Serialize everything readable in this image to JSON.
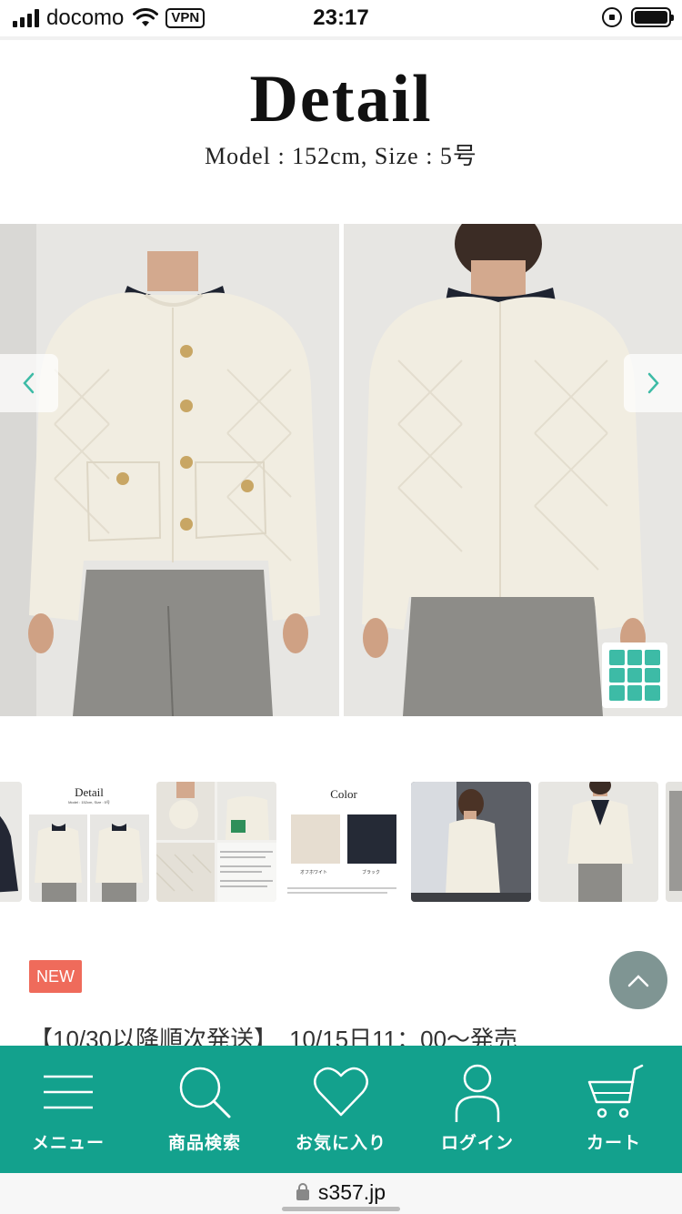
{
  "status_bar": {
    "carrier": "docomo",
    "vpn": "VPN",
    "time": "23:17",
    "signal_bars": 4,
    "battery_level": 1.0
  },
  "detail": {
    "title": "Detail",
    "subtitle": "Model : 152cm, Size : 5号"
  },
  "gallery": {
    "prev_icon": "chevron-left-icon",
    "next_icon": "chevron-right-icon",
    "grid_icon": "grid-icon"
  },
  "thumbnails": {
    "detail_card": {
      "title": "Detail",
      "subtitle": "Model : 152cm, Size : 5号"
    },
    "color_card": {
      "title": "Color",
      "swatches": [
        {
          "label": "オフホワイト",
          "color": "#e6ddd0"
        },
        {
          "label": "ブラック",
          "color": "#252a36"
        }
      ]
    }
  },
  "product": {
    "badge": "NEW",
    "title": "【10/30以降順次発送】　10/15日11：00〜発売"
  },
  "bottom_nav": {
    "items": [
      {
        "label": "メニュー",
        "icon": "menu-icon"
      },
      {
        "label": "商品検索",
        "icon": "search-icon"
      },
      {
        "label": "お気に入り",
        "icon": "heart-icon"
      },
      {
        "label": "ログイン",
        "icon": "user-icon"
      },
      {
        "label": "カート",
        "icon": "cart-icon"
      }
    ]
  },
  "url_bar": {
    "url": "s357.jp"
  },
  "colors": {
    "brand_teal": "#13a18d",
    "accent_teal": "#3dbba6",
    "badge_red": "#ef6b5b",
    "scroll_top_gray": "#7f9593"
  }
}
